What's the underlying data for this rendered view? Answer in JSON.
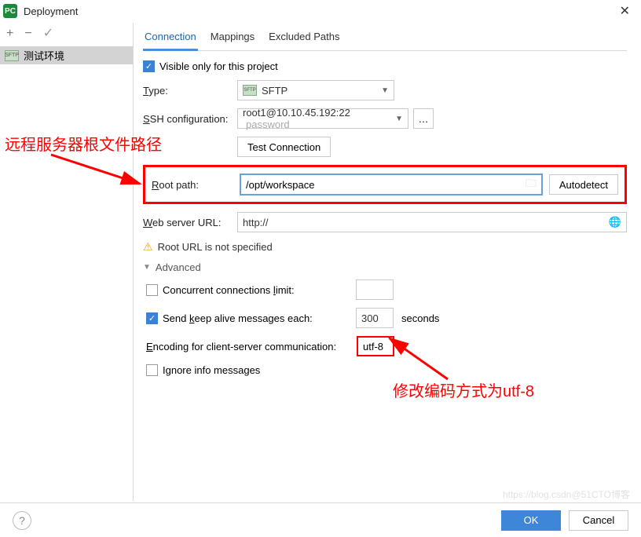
{
  "window": {
    "title": "Deployment"
  },
  "sidebar": {
    "tools": {
      "add": "+",
      "remove": "−",
      "check": "✓"
    },
    "server_label": "测试环境",
    "server_badge": "SFTP"
  },
  "tabs": {
    "connection": "Connection",
    "mappings": "Mappings",
    "excluded": "Excluded Paths"
  },
  "form": {
    "visible_only": "Visible only for this project",
    "type_label": "Type:",
    "type_value": "SFTP",
    "ssh_label": "SSH configuration:",
    "ssh_value": "root1@10.10.45.192:22",
    "ssh_placeholder": "password",
    "test_connection": "Test Connection",
    "root_label": "Root path:",
    "root_value": "/opt/workspace",
    "autodetect": "Autodetect",
    "weburl_label": "Web server URL:",
    "weburl_value": "http://",
    "warn_text": "Root URL is not specified",
    "advanced": "Advanced",
    "concurrent_label": "Concurrent connections limit:",
    "concurrent_value": "",
    "keepalive_label": "Send keep alive messages each:",
    "keepalive_value": "300",
    "keepalive_unit": "seconds",
    "encoding_label": "Encoding for client-server communication:",
    "encoding_value": "utf-8",
    "ignore_label": "Ignore info messages"
  },
  "footer": {
    "ok": "OK",
    "cancel": "Cancel"
  },
  "annotations": {
    "a1": "远程服务器根文件路径",
    "a2": "修改编码方式为utf-8"
  },
  "watermark": "https://blog.csdn@51CTO博客"
}
